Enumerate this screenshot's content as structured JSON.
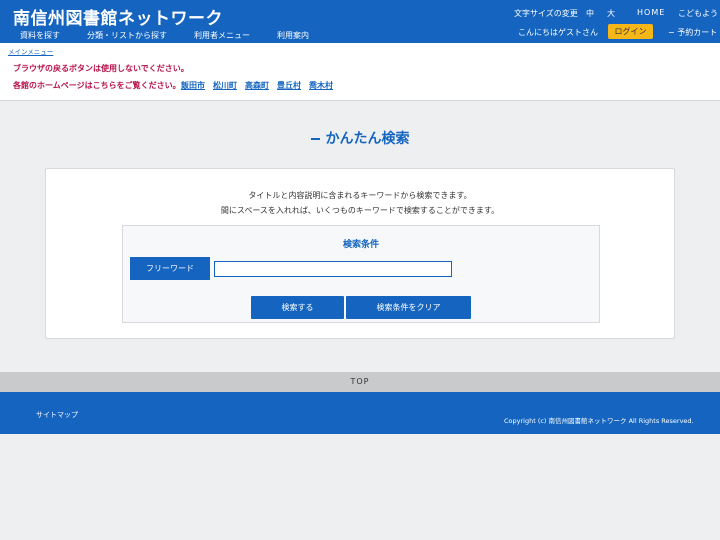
{
  "header": {
    "site_title": "南信州図書館ネットワーク",
    "nav": [
      "資料を探す",
      "分類・リストから探す",
      "利用者メニュー",
      "利用案内"
    ],
    "font_size_label": "文字サイズの変更",
    "font_size_medium": "中",
    "font_size_large": "大",
    "home": "HOME",
    "kids": "こどもよう",
    "greeting": "こんにちはゲストさん",
    "login": "ログイン",
    "cart": "予約カート"
  },
  "notice": {
    "breadcrumb": "メインメニュー",
    "warning_back": "ブラウザの戻るボタンは使用しないでください。",
    "warning_home": "各館のホームページはこちらをご覧ください。",
    "libraries": [
      "飯田市",
      "松川町",
      "高森町",
      "豊丘村",
      "喬木村"
    ]
  },
  "main": {
    "title": "かんたん検索",
    "description_1": "タイトルと内容説明に含まれるキーワードから検索できます。",
    "description_2": "間にスペースを入れれば、いくつものキーワードで検索することができます。",
    "conditions_title": "検索条件",
    "freeword_label": "フリーワード",
    "freeword_value": "",
    "search_button": "検索する",
    "clear_button": "検索条件をクリア"
  },
  "top_link": "TOP",
  "footer": {
    "sitemap": "サイトマップ",
    "copyright": "Copyright (c) 南信州図書館ネットワーク All Rights Reserved."
  },
  "colors": {
    "primary": "#1565c0",
    "warning_text": "#b7114a",
    "login_button": "#f5b718",
    "background": "#eeeff1"
  }
}
